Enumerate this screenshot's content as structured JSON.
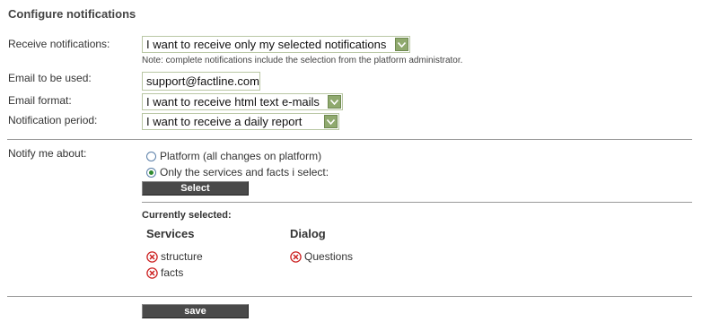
{
  "page": {
    "title": "Configure notifications"
  },
  "form": {
    "receive_notifications": {
      "label": "Receive notifications:",
      "value": "I want to receive only my selected notifications",
      "note": "Note: complete notifications include the selection from the platform administrator."
    },
    "email": {
      "label": "Email to be used:",
      "value": "support@factline.com"
    },
    "email_format": {
      "label": "Email format:",
      "value": "I want to receive html text e-mails"
    },
    "notification_period": {
      "label": "Notification period:",
      "value": "I want to receive a daily report"
    }
  },
  "notify": {
    "label": "Notify me about:",
    "options": [
      {
        "label": "Platform (all changes on platform)",
        "selected": false
      },
      {
        "label": "Only the services and facts i select:",
        "selected": true
      }
    ],
    "select_button": "Select"
  },
  "selected": {
    "heading": "Currently selected:",
    "columns": [
      {
        "heading": "Services",
        "items": [
          "structure",
          "facts"
        ]
      },
      {
        "heading": "Dialog",
        "items": [
          "Questions"
        ]
      }
    ]
  },
  "actions": {
    "save": "save"
  },
  "icons": {
    "dropdown": "chevron-down-icon",
    "remove": "remove-x-icon"
  },
  "colors": {
    "dropdown_arrow_bg": "#8fa96e",
    "field_border": "#b9c7a4",
    "button_bg": "#4a4a4a",
    "remove_icon": "#cc2222",
    "radio_selected": "#2f8a2f"
  }
}
